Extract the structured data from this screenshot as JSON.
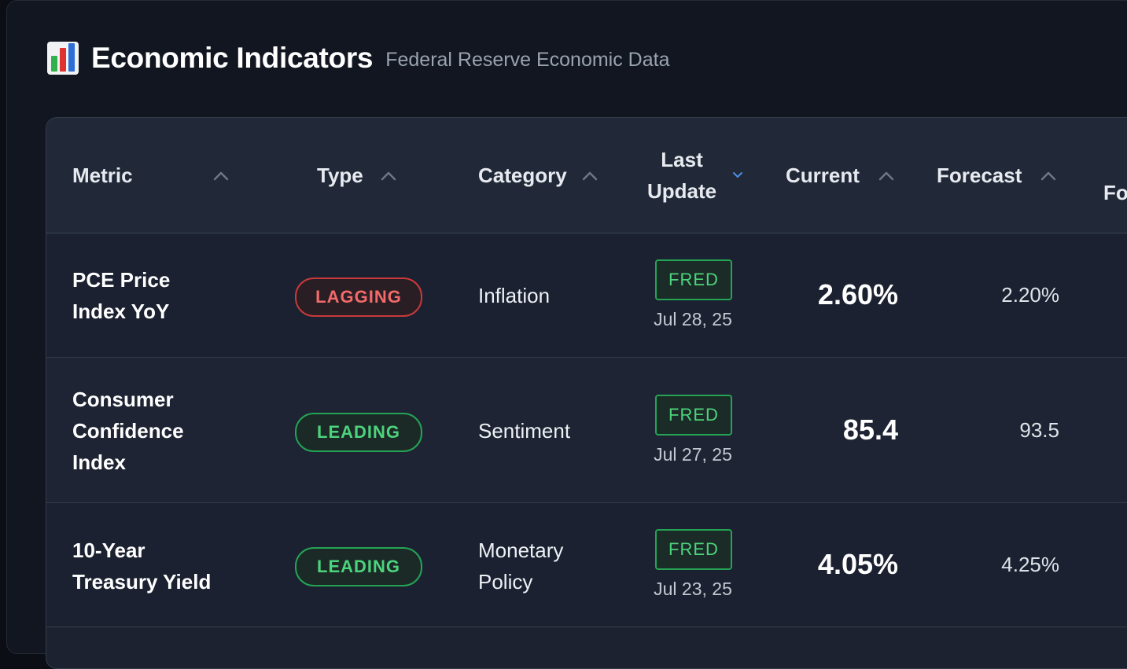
{
  "page": {
    "icon": "bar-chart-icon",
    "title": "Economic Indicators",
    "subtitle": "Federal Reserve Economic Data"
  },
  "table": {
    "columns": {
      "metric": "Metric",
      "type": "Type",
      "category": "Category",
      "last_update_line1": "Last",
      "last_update_line2": "Update",
      "current": "Current",
      "forecast": "Forecast",
      "next_partial": "Fo"
    },
    "active_sort": "last_update",
    "rows": [
      {
        "metric_line1": "PCE Price",
        "metric_line2": "Index YoY",
        "metric_line3": "",
        "type": "LAGGING",
        "category_line1": "Inflation",
        "category_line2": "",
        "source": "FRED",
        "date": "Jul 28, 25",
        "current": "2.60%",
        "forecast": "2.20%"
      },
      {
        "metric_line1": "Consumer",
        "metric_line2": "Confidence",
        "metric_line3": "Index",
        "type": "LEADING",
        "category_line1": "Sentiment",
        "category_line2": "",
        "source": "FRED",
        "date": "Jul 27, 25",
        "current": "85.4",
        "forecast": "93.5"
      },
      {
        "metric_line1": "10-Year",
        "metric_line2": "Treasury Yield",
        "metric_line3": "",
        "type": "LEADING",
        "category_line1": "Monetary",
        "category_line2": "Policy",
        "source": "FRED",
        "date": "Jul 23, 25",
        "current": "4.05%",
        "forecast": "4.25%"
      }
    ]
  },
  "colors": {
    "background": "#111620",
    "lagging": "#f26a6a",
    "leading": "#4cd47c",
    "sort_active": "#4a90e2"
  }
}
